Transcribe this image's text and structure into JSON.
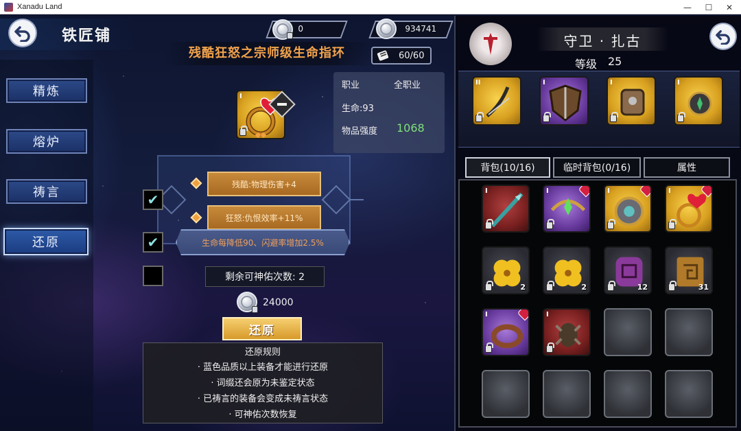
{
  "window": {
    "title": "Xanadu Land",
    "minimize": "—",
    "maximize": "☐",
    "close": "✕"
  },
  "header": {
    "title": "铁匠铺",
    "currency_locked": "0",
    "currency_silver": "934741"
  },
  "bag_capacity": "60/60",
  "nav": {
    "items": [
      {
        "label": "精炼"
      },
      {
        "label": "熔炉"
      },
      {
        "label": "祷言"
      },
      {
        "label": "还原"
      }
    ],
    "active": "还原"
  },
  "item": {
    "name": "残酷狂怒之宗师级生命指环",
    "rank": "I",
    "class_label": "职业",
    "class_value": "全职业",
    "hp_label": "生命:93",
    "strength_label": "物品强度",
    "strength_value": "1068",
    "strength_color": "#7fe07a",
    "name_color": "#f2a34c"
  },
  "affixes": [
    {
      "text": "残酷:物理伤害+4"
    },
    {
      "text": "狂怒:仇恨效率+11%"
    }
  ],
  "blessing": {
    "text": "生命每降低90、闪避率增加2.5%"
  },
  "remaining": "剩余可神佑次数: 2",
  "cost": "24000",
  "restore_button": "还原",
  "rules": {
    "title": "还原规则",
    "lines": [
      "· 蓝色品质以上装备才能进行还原",
      "· 词缀还会原为未鉴定状态",
      "· 已祷言的装备会变成未祷言状态",
      "· 可神佑次数恢复"
    ]
  },
  "character": {
    "name": "守卫 · 扎古",
    "level_label": "等级",
    "level": "25",
    "equipment": [
      {
        "name": "bow-icon",
        "rank": "II",
        "quality": "gold"
      },
      {
        "name": "shield-icon",
        "rank": "I",
        "quality": "purple"
      },
      {
        "name": "armor-icon",
        "rank": "I",
        "quality": "gold"
      },
      {
        "name": "amulet-icon",
        "rank": "I",
        "quality": "gold"
      }
    ]
  },
  "tabs": [
    {
      "label": "背包(10/16)"
    },
    {
      "label": "临时背包(0/16)"
    },
    {
      "label": "属性"
    }
  ],
  "inventory": [
    {
      "name": "spear-icon",
      "rank": "I",
      "quality": "red",
      "heart": false,
      "count": ""
    },
    {
      "name": "crossbow-icon",
      "rank": "I",
      "quality": "purple",
      "heart": true,
      "count": ""
    },
    {
      "name": "shield-orb-icon",
      "rank": "I",
      "quality": "gold",
      "heart": true,
      "count": ""
    },
    {
      "name": "ring-icon",
      "rank": "I",
      "quality": "gold",
      "heart": true,
      "count": ""
    },
    {
      "name": "flower-icon",
      "rank": "",
      "quality": "dark",
      "heart": false,
      "count": "2"
    },
    {
      "name": "flower-icon",
      "rank": "",
      "quality": "dark",
      "heart": false,
      "count": "2"
    },
    {
      "name": "purple-rune-icon",
      "rank": "",
      "quality": "dark",
      "heart": false,
      "count": "12"
    },
    {
      "name": "gold-rune-icon",
      "rank": "",
      "quality": "dark",
      "heart": false,
      "count": "31"
    },
    {
      "name": "bracelet-icon",
      "rank": "I",
      "quality": "purple",
      "heart": true,
      "count": ""
    },
    {
      "name": "claw-armor-icon",
      "rank": "I",
      "quality": "red",
      "heart": false,
      "count": ""
    },
    {
      "name": "empty-slot",
      "rank": "",
      "quality": "empty",
      "heart": false,
      "count": ""
    },
    {
      "name": "empty-slot",
      "rank": "",
      "quality": "empty",
      "heart": false,
      "count": ""
    },
    {
      "name": "empty-slot",
      "rank": "",
      "quality": "empty",
      "heart": false,
      "count": ""
    },
    {
      "name": "empty-slot",
      "rank": "",
      "quality": "empty",
      "heart": false,
      "count": ""
    },
    {
      "name": "empty-slot",
      "rank": "",
      "quality": "empty",
      "heart": false,
      "count": ""
    },
    {
      "name": "empty-slot",
      "rank": "",
      "quality": "empty",
      "heart": false,
      "count": ""
    }
  ]
}
